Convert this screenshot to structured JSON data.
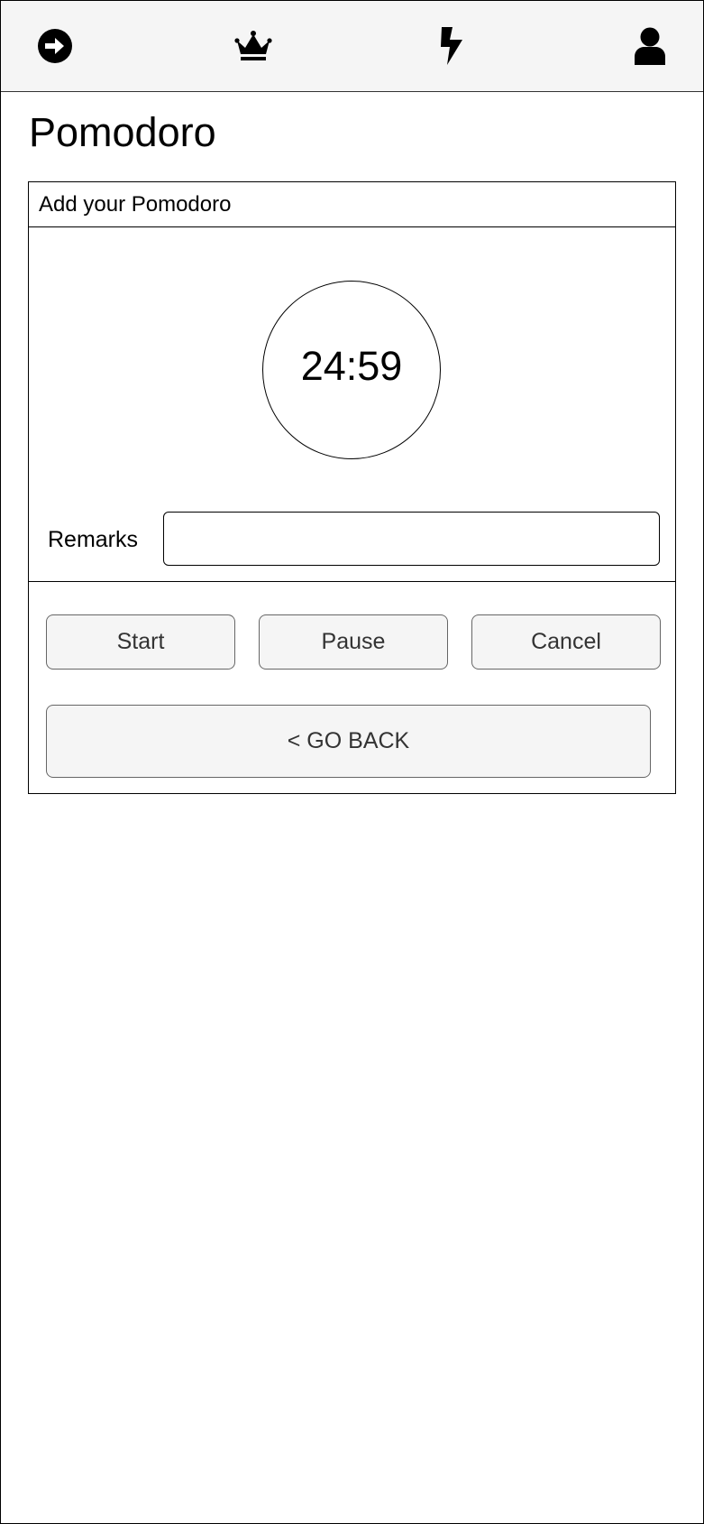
{
  "nav": {
    "items": [
      {
        "icon": "arrow-right-circle-icon"
      },
      {
        "icon": "crown-icon"
      },
      {
        "icon": "lightning-bolt-icon"
      },
      {
        "icon": "user-icon"
      }
    ]
  },
  "page": {
    "title": "Pomodoro"
  },
  "card": {
    "header": "Add your Pomodoro",
    "timer": "24:59",
    "remarks": {
      "label": "Remarks",
      "value": "",
      "placeholder": ""
    },
    "buttons": {
      "start": "Start",
      "pause": "Pause",
      "cancel": "Cancel",
      "back": "< GO BACK"
    }
  }
}
